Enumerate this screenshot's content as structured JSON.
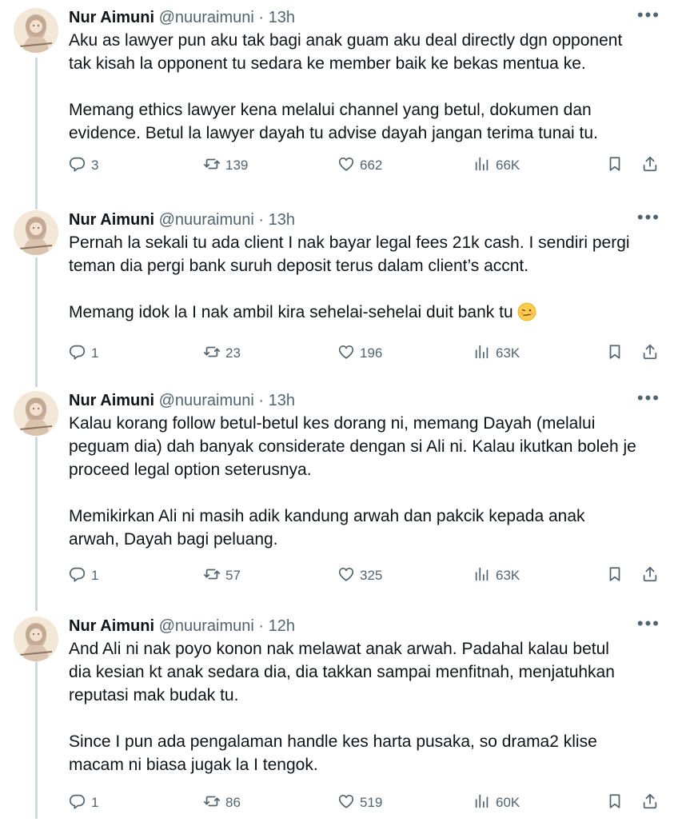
{
  "tweets": [
    {
      "name": "Nur Aimuni",
      "handle": "@nuuraimuni",
      "sep": "·",
      "time": "13h",
      "paragraphs": [
        [
          "Aku as lawyer pun aku tak bagi anak guam aku deal directly dgn opponent",
          "tak kisah la opponent tu sedara ke member baik ke bekas mentua ke."
        ],
        [
          "Memang ethics lawyer kena melalui channel yang betul, dokumen dan",
          "evidence. Betul la lawyer dayah tu advise dayah jangan terima tunai tu."
        ]
      ],
      "replies": "3",
      "retweets": "139",
      "likes": "662",
      "views": "66K"
    },
    {
      "name": "Nur Aimuni",
      "handle": "@nuuraimuni",
      "sep": "·",
      "time": "13h",
      "paragraphs": [
        [
          "Pernah la sekali tu ada client I nak bayar legal fees 21k cash. I sendiri pergi",
          "teman dia pergi bank suruh deposit terus dalam client’s accnt."
        ],
        [
          "Memang idok la I nak ambil kira sehelai-sehelai duit bank tu"
        ]
      ],
      "emoji": "woozy-face-emoji",
      "replies": "1",
      "retweets": "23",
      "likes": "196",
      "views": "63K"
    },
    {
      "name": "Nur Aimuni",
      "handle": "@nuuraimuni",
      "sep": "·",
      "time": "13h",
      "paragraphs": [
        [
          "Kalau korang follow betul-betul kes dorang ni, memang Dayah (melalui",
          "peguam dia) dah banyak considerate dengan si Ali ni. Kalau ikutkan boleh je",
          "proceed legal option seterusnya."
        ],
        [
          "Memikirkan Ali ni masih adik kandung arwah dan pakcik kepada anak",
          "arwah, Dayah bagi peluang."
        ]
      ],
      "replies": "1",
      "retweets": "57",
      "likes": "325",
      "views": "63K"
    },
    {
      "name": "Nur Aimuni",
      "handle": "@nuuraimuni",
      "sep": "·",
      "time": "12h",
      "paragraphs": [
        [
          "And Ali ni nak poyo konon nak melawat anak arwah. Padahal kalau betul",
          "dia kesian kt anak sedara dia, dia takkan  sampai menfitnah, menjatuhkan",
          "reputasi mak budak tu."
        ],
        [
          "Since I pun ada pengalaman handle kes harta pusaka, so drama2 klise",
          "macam ni biasa jugak la I tengok."
        ]
      ],
      "replies": "1",
      "retweets": "86",
      "likes": "519",
      "views": "60K"
    }
  ],
  "icons": {
    "reply": "reply-icon",
    "retweet": "retweet-icon",
    "like": "heart-icon",
    "views": "views-icon",
    "bookmark": "bookmark-icon",
    "share": "share-icon",
    "more": "more-dots-icon"
  },
  "colors": {
    "text": "#0f1419",
    "secondary": "#536471",
    "thread_line": "#cfd9de"
  }
}
